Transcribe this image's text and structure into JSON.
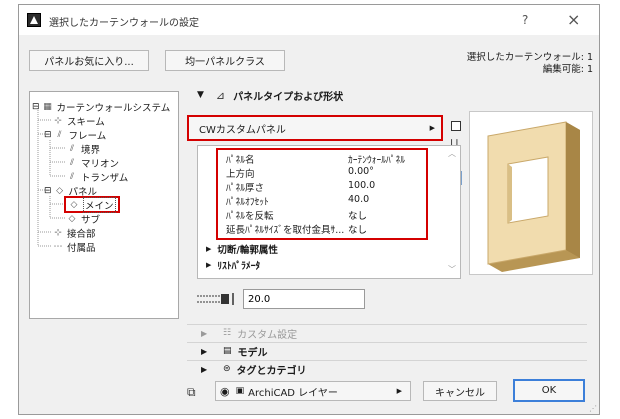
{
  "window": {
    "title": "選択したカーテンウォールの設定",
    "help_label": "?",
    "close_label": "×"
  },
  "toolbar": {
    "favorites_label": "パネルお気に入り...",
    "uniform_panel_class_label": "均一パネルクラス",
    "status_line1": "選択したカーテンウォール: 1",
    "status_line2": "編集可能: 1"
  },
  "tree": {
    "items": [
      {
        "label": "カーテンウォールシステム",
        "toggle": "⊟"
      },
      {
        "label": "スキーム",
        "toggle": ""
      },
      {
        "label": "フレーム",
        "toggle": "⊟"
      },
      {
        "label": "境界",
        "toggle": ""
      },
      {
        "label": "マリオン",
        "toggle": ""
      },
      {
        "label": "トランザム",
        "toggle": ""
      },
      {
        "label": "パネル",
        "toggle": "⊟"
      },
      {
        "label": "メイン",
        "toggle": ""
      },
      {
        "label": "サブ",
        "toggle": ""
      },
      {
        "label": "接合部",
        "toggle": ""
      },
      {
        "label": "付属品",
        "toggle": ""
      }
    ]
  },
  "panel_section": {
    "title": "パネルタイプおよび形状",
    "panel_type_value": "CWカスタムパネル",
    "properties": [
      {
        "name": "ﾊﾟﾈﾙ名",
        "value": "ｶｰﾃﾝｳｫｰﾙﾊﾟﾈﾙ"
      },
      {
        "name": "上方向",
        "value": "0.00°"
      },
      {
        "name": "ﾊﾟﾈﾙ厚さ",
        "value": "100.0"
      },
      {
        "name": "ﾊﾟﾈﾙｵﾌｾｯﾄ",
        "value": "40.0"
      },
      {
        "name": "ﾊﾟﾈﾙを反転",
        "value": "なし"
      },
      {
        "name": "延長ﾊﾟﾈﾙｻｲｽﾞを取付金具ｻ...",
        "value": "なし"
      }
    ],
    "subsection_cut": "切断/輪郭属性",
    "subsection_params": "ﾘｽﾄﾊﾟﾗﾒｰﾀ",
    "thickness_value": "20.0"
  },
  "sections": {
    "custom": "カスタム設定",
    "model": "モデル",
    "tags": "タグとカテゴリ"
  },
  "footer": {
    "layer_label": "ArchiCAD レイヤー",
    "cancel_label": "キャンセル",
    "ok_label": "OK"
  },
  "colors": {
    "highlight": "#d40000",
    "ok_border": "#3c7fd9",
    "panel_face": "#f1dcae",
    "panel_edge": "#c9a86a"
  }
}
